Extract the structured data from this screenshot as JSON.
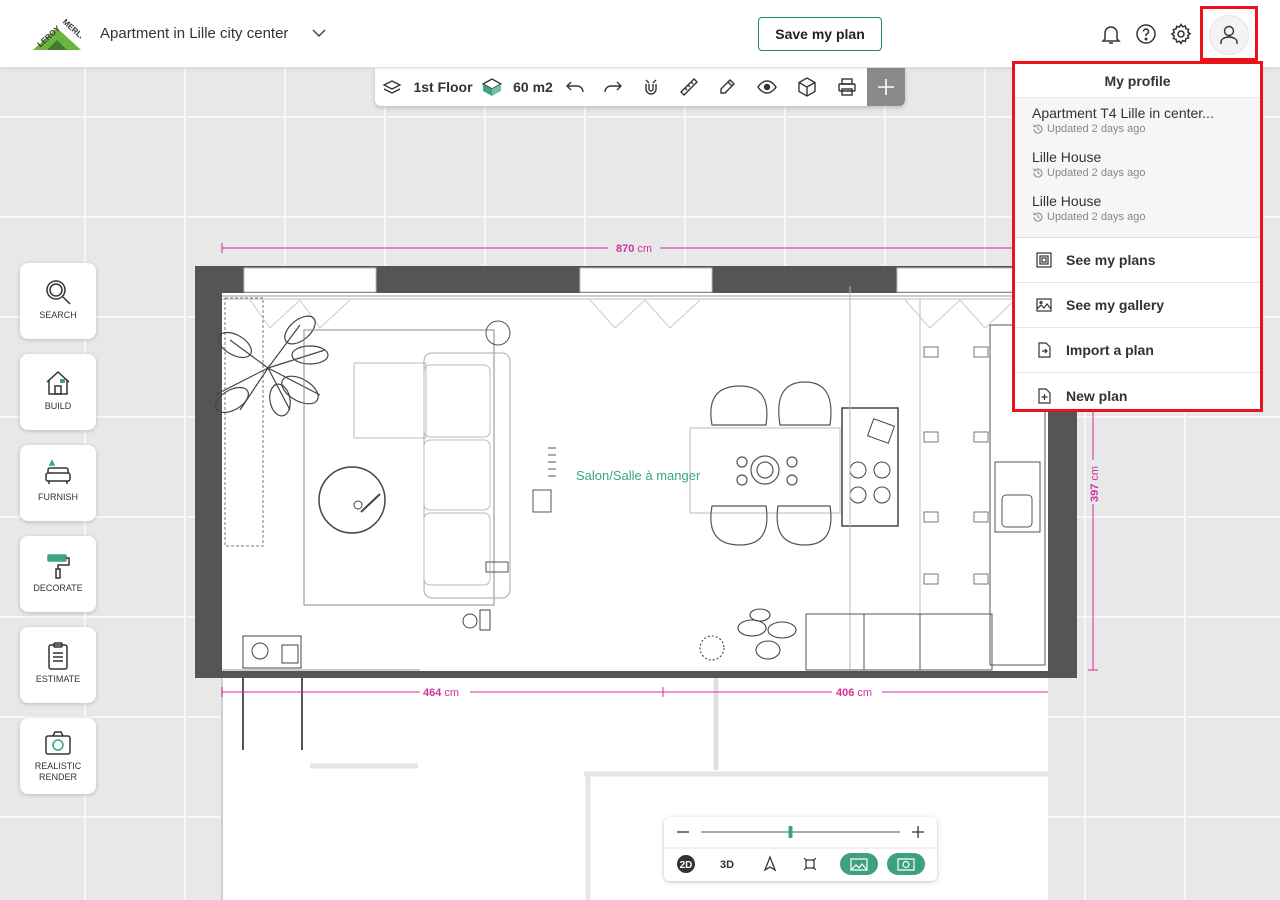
{
  "header": {
    "project_title": "Apartment in Lille city center",
    "save_label": "Save my plan",
    "brand_name": "LEROY MERLIN",
    "brand_color": "#6cb33f"
  },
  "toolbar": {
    "floor_label": "1st Floor",
    "area_label": "60 m2"
  },
  "sidebar": {
    "items": [
      {
        "label": "SEARCH",
        "icon": "search-icon"
      },
      {
        "label": "BUILD",
        "icon": "house-icon"
      },
      {
        "label": "FURNISH",
        "icon": "sofa-icon"
      },
      {
        "label": "DECORATE",
        "icon": "paint-roller-icon"
      },
      {
        "label": "ESTIMATE",
        "icon": "clipboard-icon"
      },
      {
        "label": "REALISTIC RENDER",
        "icon": "camera-icon"
      }
    ]
  },
  "plan": {
    "room_label": "Salon/Salle à manger",
    "dim_top": "870",
    "dim_right": "397",
    "dim_bottom_left": "464",
    "dim_bottom_right": "406",
    "unit": "cm",
    "dimension_color": "#d0319d",
    "accent_color": "#3aa57f"
  },
  "view_controls": {
    "mode_2d": "2D",
    "mode_3d": "3D",
    "zoom_level": 0.45,
    "accent_color": "#3f9f82"
  },
  "profile_menu": {
    "title": "My profile",
    "recent": [
      {
        "name": "Apartment T4 Lille in center...",
        "updated": "Updated 2 days ago"
      },
      {
        "name": "Lille House",
        "updated": "Updated 2 days ago"
      },
      {
        "name": "Lille House",
        "updated": "Updated 2 days ago"
      }
    ],
    "actions": [
      {
        "label": "See my plans",
        "icon": "plans-icon"
      },
      {
        "label": "See my gallery",
        "icon": "gallery-icon"
      },
      {
        "label": "Import a plan",
        "icon": "import-icon"
      },
      {
        "label": "New plan",
        "icon": "new-plan-icon"
      }
    ],
    "highlight_color": "#e8131b"
  }
}
